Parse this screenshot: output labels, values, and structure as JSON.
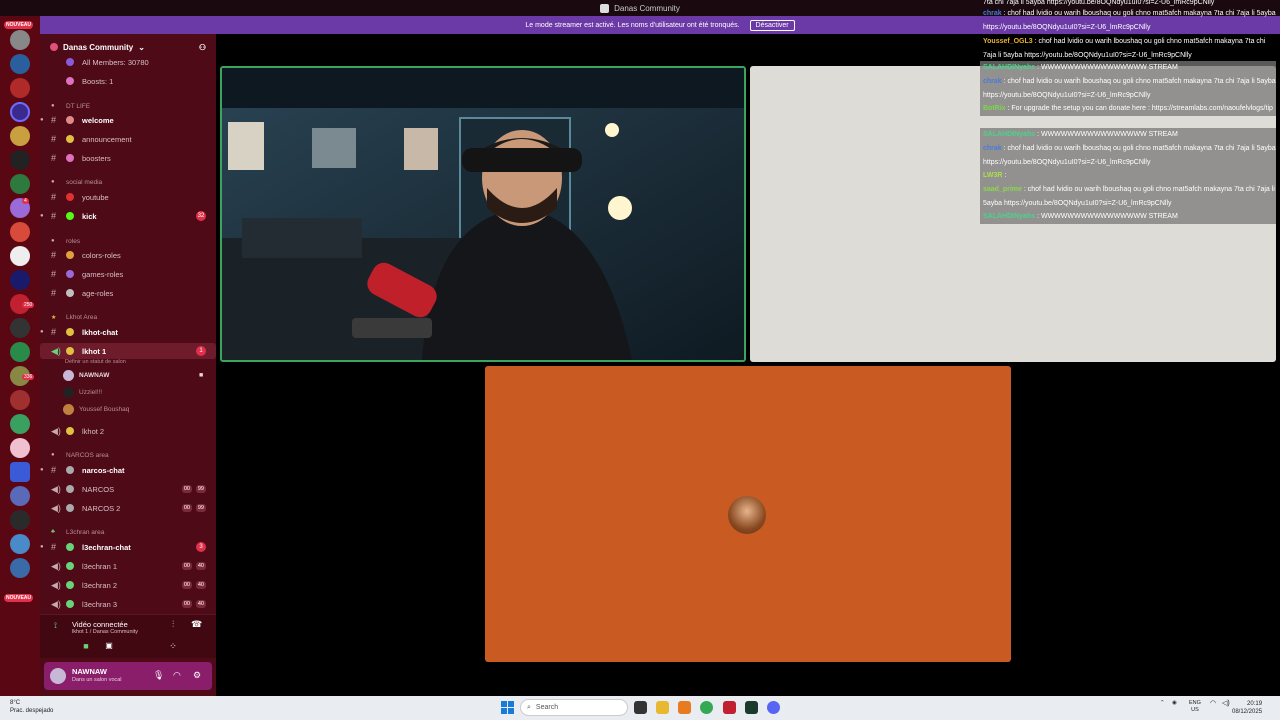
{
  "window": {
    "title": "Danas Community"
  },
  "banner": {
    "text": "Le mode streamer est activé. Les noms d'utilisateur ont été tronqués.",
    "button_label": "Désactiver"
  },
  "rail": {
    "badge_top": "123",
    "new_label": "NOUVEAU",
    "new_label_bottom": "NOUVEAU",
    "badges": [
      "34",
      "4",
      "7",
      "12",
      "26",
      "7",
      "250",
      "10",
      "336",
      "2",
      "40",
      "3",
      "40",
      "2",
      "16",
      "4",
      "5"
    ]
  },
  "server": {
    "name": "Danas Community"
  },
  "channels": {
    "all_members": "All Members: 30780",
    "boosts": "Boosts: 1",
    "cat_dtlife": "DT LIFE",
    "welcome": "welcome",
    "announcement": "announcement",
    "boosters": "boosters",
    "cat_social": "social media",
    "youtube": "youtube",
    "kick": "kick",
    "kick_badge": "32",
    "cat_roles": "roles",
    "colors_roles": "colors-roles",
    "games_roles": "games-roles",
    "age_roles": "age-roles",
    "cat_lkhot": "Lkhot Area",
    "lkhot_chat": "lkhot-chat",
    "lkhot1": "lkhot 1",
    "lkhot1_badge": "1",
    "status_hint": "Définir un statut de salon",
    "voice_users": [
      "NAWNAW",
      "Uzziel!!!",
      "Youssef Boushaq"
    ],
    "lkhot2": "lkhot 2",
    "cat_narcos": "NARCOS area",
    "narcos_chat": "narcos-chat",
    "narcos1": "NARCOS",
    "narcos2": "NARCOS 2",
    "narcos_count": "00",
    "narcos_limit": "99",
    "cat_l3": "L3chran area",
    "l3_chat": "l3echran-chat",
    "l3_chat_badge": "3",
    "l3_1": "l3echran 1",
    "l3_2": "l3echran 2",
    "l3_3": "l3echran 3",
    "l3_count": "00",
    "l3_limit": "40"
  },
  "voice_panel": {
    "status": "Vidéo connectée",
    "location": "lkhot 1 / Danas Community"
  },
  "user_panel": {
    "name": "NAWNAW",
    "status": "Dans un salon vocal"
  },
  "chat": [
    {
      "user": "",
      "text": "7ta chi 7aja li 5ayba https://youtu.be/8OQNdyu1uI0?si=Z-U6_lmRc9pCNlly",
      "color": "#ffffff",
      "bg": false
    },
    {
      "user": "chrak",
      "text": ": chof had lvidio ou warih lboushaq ou goli chno mat5afch makayna 7ta chi 7aja li 5ayba https://youtu.be/8OQNdyu1uI0?si=Z-U6_lmRc9pCNlly",
      "color": "#4a7ad8",
      "bg": false
    },
    {
      "user": "Youssef_OGL3",
      "text": ": chof had lvidio ou warih lboushaq ou goli chno mat5afch makayna 7ta chi 7aja li 5ayba https://youtu.be/8OQNdyu1uI0?si=Z-U6_lmRc9pCNlly",
      "color": "#e8b230",
      "bg": false
    },
    {
      "user": "SALAHDINyahs",
      "text": ": WWWWWWWWWWWWWWWW STREAM",
      "color": "#4ad48a",
      "bg": true
    },
    {
      "user": "chrak",
      "text": ": chof had lvidio ou warih lboushaq ou goli chno mat5afch makayna 7ta chi 7aja li 5ayba https://youtu.be/8OQNdyu1uI0?si=Z-U6_lmRc9pCNlly",
      "color": "#4a7ad8",
      "bg": true
    },
    {
      "user": "BotRix",
      "text": ": For upgrade the setup you can donate here : https://streamlabs.com/naoufelvlogs/tip",
      "color": "#7ad84a",
      "bg": true
    },
    {
      "user": "SALAHDINyahs",
      "text": ": WWWWWWWWWWWWWWWW STREAM",
      "color": "#4ad48a",
      "bg": true
    },
    {
      "user": "chrak",
      "text": ": chof had lvidio ou warih lboushaq ou goli chno mat5afch makayna 7ta chi 7aja li 5ayba https://youtu.be/8OQNdyu1uI0?si=Z-U6_lmRc9pCNlly",
      "color": "#4a7ad8",
      "bg": true
    },
    {
      "user": "LW3R",
      "text": ":",
      "color": "#a8e04a",
      "bg": true
    },
    {
      "user": "saad_prime",
      "text": ": chof had lvidio ou warih lboushaq ou goli chno mat5afch makayna 7ta chi 7aja li 5ayba https://youtu.be/8OQNdyu1uI0?si=Z-U6_lmRc9pCNlly",
      "color": "#8ad84a",
      "bg": true
    },
    {
      "user": "SALAHDINyahs",
      "text": ": WWWWWWWWWWWWWWWW STREAM",
      "color": "#4ad48a",
      "bg": true
    }
  ],
  "taskbar": {
    "temp": "8°C",
    "weather": "Prac. despejado",
    "search_placeholder": "Search",
    "lang1": "ENG",
    "lang2": "US",
    "time": "20:19",
    "date": "08/12/2025"
  },
  "colors": {
    "sidebar": "#4e0a16",
    "rail": "#5a0714",
    "banner": "#6c3aa6",
    "cam_border": "#3ba55d",
    "orange_tile": "#c85a22"
  }
}
